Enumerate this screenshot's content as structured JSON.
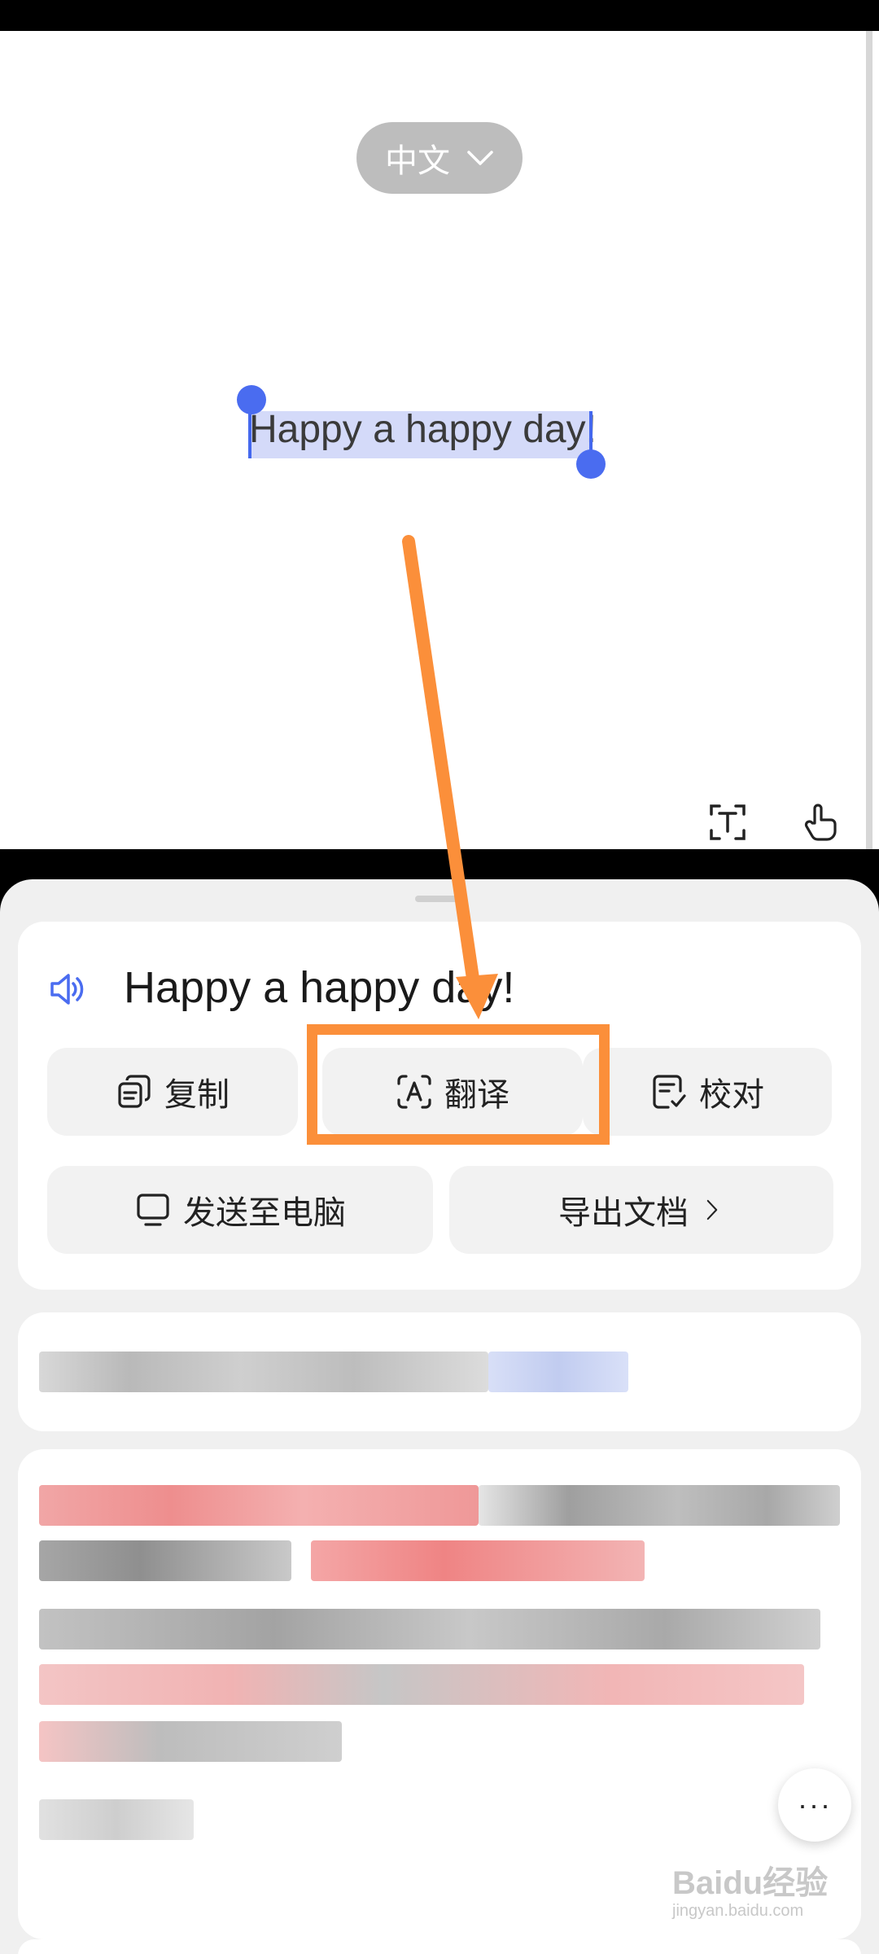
{
  "language_selector": {
    "label": "中文"
  },
  "preview": {
    "selected_text": "Happy a happy day",
    "trailing_text": "!"
  },
  "result": {
    "text": "Happy a happy day!"
  },
  "actions": {
    "copy": "复制",
    "translate": "翻译",
    "proofread": "校对",
    "send_to_pc": "发送至电脑",
    "export_doc": "导出文档"
  },
  "more_button": {
    "label": "···"
  },
  "watermark": {
    "main": "Baidu经验",
    "sub": "jingyan.baidu.com"
  },
  "colors": {
    "accent": "#4a6cf0",
    "annotation": "#fb8f3a"
  }
}
